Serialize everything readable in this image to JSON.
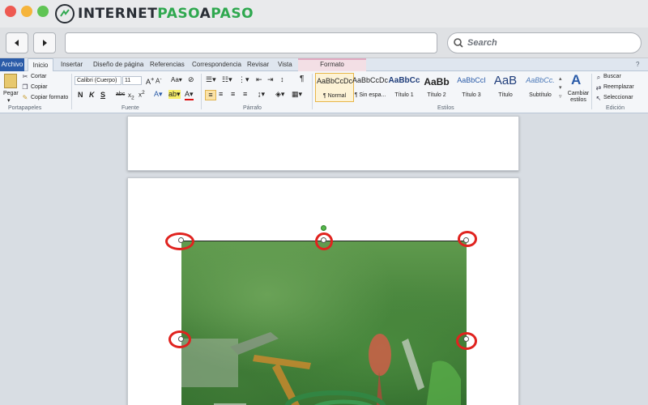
{
  "brand": {
    "name_part1": "INTERNET",
    "name_part2": "PASO",
    "name_part3": "A",
    "name_part4": "PASO"
  },
  "browser": {
    "address_value": "",
    "search_label": "Search"
  },
  "ribbon_tabs": [
    "Archivo",
    "Inicio",
    "Insertar",
    "Diseño de página",
    "Referencias",
    "Correspondencia",
    "Revisar",
    "Vista",
    "Formato"
  ],
  "clipboard": {
    "paste": "Pegar",
    "cut": "Cortar",
    "copy": "Copiar",
    "format_painter": "Copiar formato",
    "group": "Portapapeles"
  },
  "font": {
    "family": "Calibri (Cuerpo)",
    "size": "11",
    "group": "Fuente"
  },
  "paragraph": {
    "group": "Párrafo"
  },
  "styles": {
    "group": "Estilos",
    "items": [
      {
        "sample": "AaBbCcDc",
        "name": "¶ Normal"
      },
      {
        "sample": "AaBbCcDc",
        "name": "¶ Sin espa..."
      },
      {
        "sample": "AaBbCc",
        "name": "Título 1"
      },
      {
        "sample": "AaBb",
        "name": "Título 2"
      },
      {
        "sample": "AaBbCcI",
        "name": "Título 3"
      },
      {
        "sample": "AaB",
        "name": "Título"
      },
      {
        "sample": "AaBbCc.",
        "name": "Subtítulo"
      }
    ],
    "change": "Cambiar estilos"
  },
  "editing": {
    "find": "Buscar",
    "replace": "Reemplazar",
    "select": "Seleccionar",
    "group": "Edición"
  },
  "colors": {
    "brand_accent": "#2fa84f",
    "highlight_ring": "#e0231f",
    "archivo_tab": "#2a5ba8",
    "formato_tab": "#f3dfe5"
  }
}
